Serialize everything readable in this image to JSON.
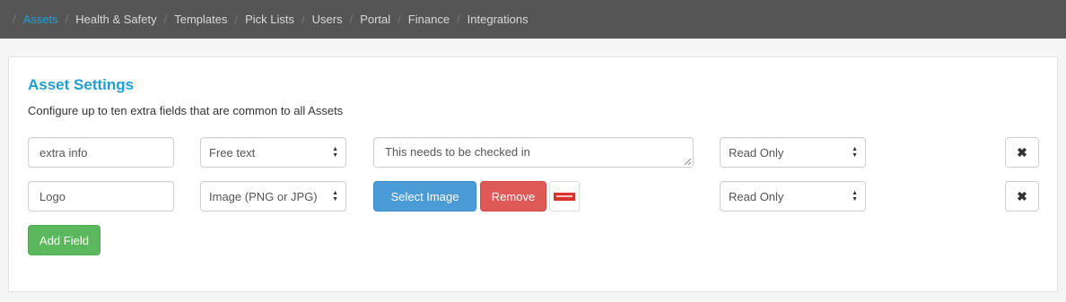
{
  "nav": {
    "items": [
      {
        "label": "Assets",
        "active": true
      },
      {
        "label": "Health & Safety"
      },
      {
        "label": "Templates"
      },
      {
        "label": "Pick Lists"
      },
      {
        "label": "Users"
      },
      {
        "label": "Portal"
      },
      {
        "label": "Finance"
      },
      {
        "label": "Integrations"
      }
    ],
    "separator": "/"
  },
  "panel": {
    "title": "Asset Settings",
    "description": "Configure up to ten extra fields that are common to all Assets"
  },
  "rows": [
    {
      "name": "extra info",
      "type": "Free text",
      "default_value": "This needs to be checked in",
      "access": "Read Only",
      "remove_icon": "times-icon"
    },
    {
      "name": "Logo",
      "type": "Image (PNG or JPG)",
      "select_image_label": "Select Image",
      "remove_label": "Remove",
      "thumbnail_icon": "logo-thumbnail",
      "access": "Read Only",
      "remove_icon": "times-icon"
    }
  ],
  "add_field_label": "Add Field",
  "colors": {
    "nav_bg": "#555555",
    "accent": "#1f9fd1",
    "primary_button": "#4a9bd6",
    "danger_button": "#dd5a57",
    "success_button": "#5cb85c"
  }
}
